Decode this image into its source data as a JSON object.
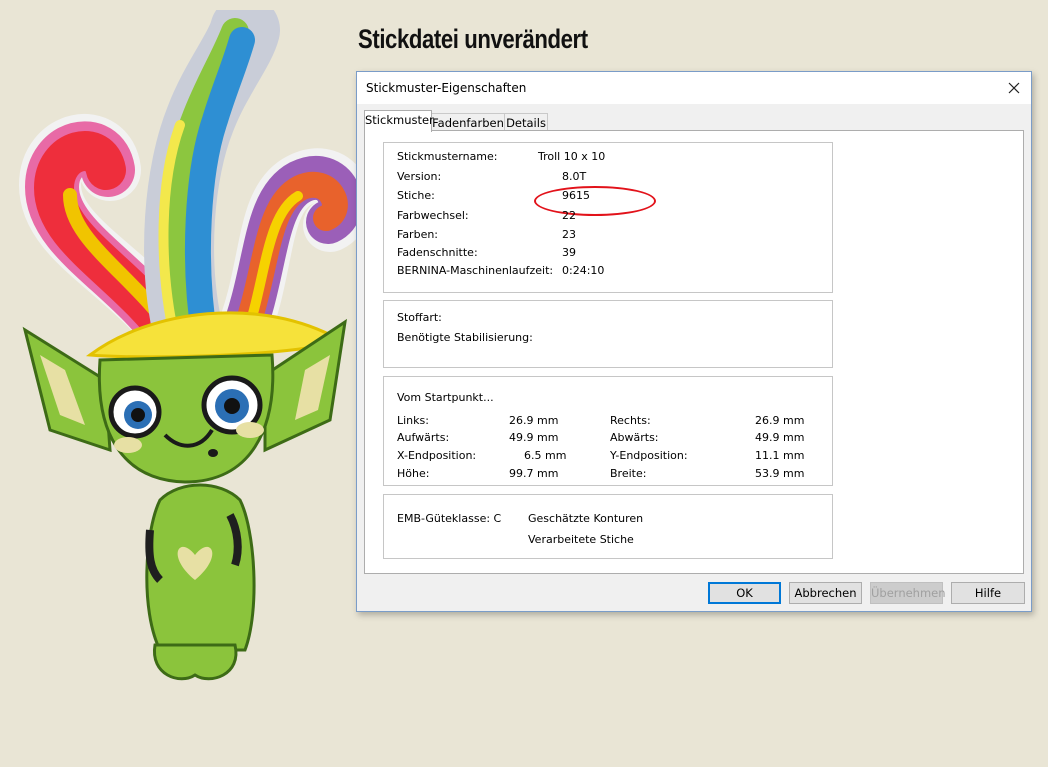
{
  "heading": "Stickdatei unverändert",
  "dialog": {
    "title": "Stickmuster-Eigenschaften",
    "tabs": [
      "Stickmuster",
      "Fadenfarben",
      "Details"
    ],
    "info": [
      {
        "label": "Stickmustername:",
        "value": "Troll 10 x 10"
      },
      {
        "label": "Version:",
        "value": "8.0T"
      },
      {
        "label": "Stiche:",
        "value": "9615"
      },
      {
        "label": "Farbwechsel:",
        "value": "22"
      },
      {
        "label": "Farben:",
        "value": "23"
      },
      {
        "label": "Fadenschnitte:",
        "value": "39"
      },
      {
        "label": "BERNINA-Maschinenlaufzeit:",
        "value": "0:24:10"
      }
    ],
    "fabric": {
      "stoffart": "Stoffart:",
      "stabilizer": "Benötigte Stabilisierung:"
    },
    "start": {
      "header": "Vom Startpunkt...",
      "rows": [
        {
          "l1": "Links:",
          "v1": "26.9 mm",
          "l2": "Rechts:",
          "v2": "26.9 mm"
        },
        {
          "l1": "Aufwärts:",
          "v1": "49.9 mm",
          "l2": "Abwärts:",
          "v2": "49.9 mm"
        },
        {
          "l1": "X-Endposition:",
          "v1": "6.5 mm",
          "l2": "Y-Endposition:",
          "v2": "11.1 mm"
        },
        {
          "l1": "Höhe:",
          "v1": "99.7 mm",
          "l2": "Breite:",
          "v2": "53.9 mm"
        }
      ]
    },
    "quality": {
      "class": "EMB-Güteklasse: C",
      "contours": "Geschätzte Konturen",
      "stitches": "Verarbeitete Stiche"
    },
    "buttons": {
      "ok": "OK",
      "cancel": "Abbrechen",
      "apply": "Übernehmen",
      "help": "Hilfe"
    }
  },
  "colors": {
    "highlight_ring": "#e2121a",
    "ok_border": "#0078d7"
  }
}
